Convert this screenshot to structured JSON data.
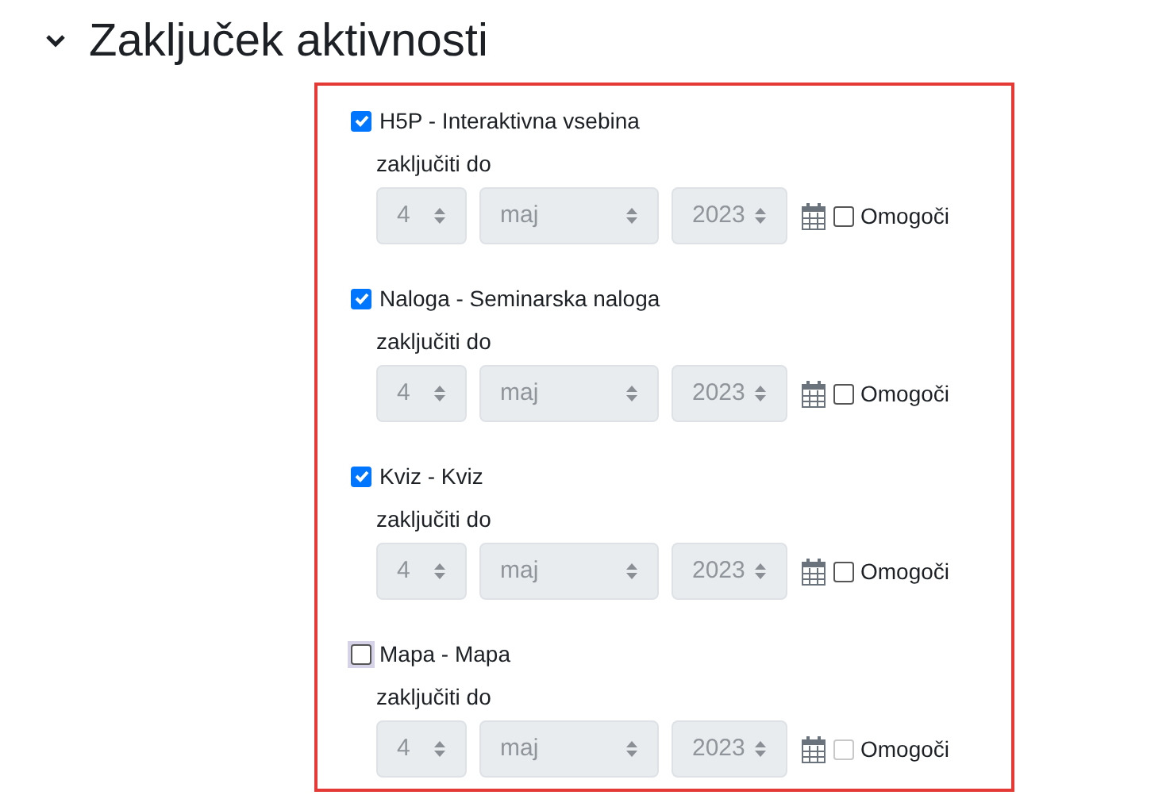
{
  "section": {
    "title": "Zaključek aktivnosti",
    "expanded": true
  },
  "activities": [
    {
      "label": "H5P - Interaktivna vsebina",
      "checked": true,
      "focused": false,
      "until_label": "zaključiti do",
      "day": "4",
      "month": "maj",
      "year": "2023",
      "enable_label": "Omogoči",
      "enable_checked": false,
      "enable_disabled": false
    },
    {
      "label": "Naloga - Seminarska naloga",
      "checked": true,
      "focused": false,
      "until_label": "zaključiti do",
      "day": "4",
      "month": "maj",
      "year": "2023",
      "enable_label": "Omogoči",
      "enable_checked": false,
      "enable_disabled": false
    },
    {
      "label": "Kviz - Kviz",
      "checked": true,
      "focused": false,
      "until_label": "zaključiti do",
      "day": "4",
      "month": "maj",
      "year": "2023",
      "enable_label": "Omogoči",
      "enable_checked": false,
      "enable_disabled": false
    },
    {
      "label": "Mapa - Mapa",
      "checked": false,
      "focused": true,
      "until_label": "zaključiti do",
      "day": "4",
      "month": "maj",
      "year": "2023",
      "enable_label": "Omogoči",
      "enable_checked": false,
      "enable_disabled": true
    }
  ]
}
